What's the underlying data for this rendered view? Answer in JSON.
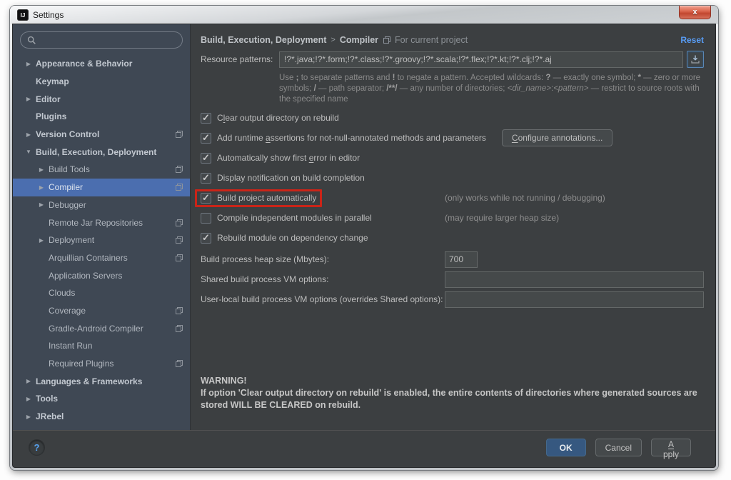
{
  "window": {
    "title": "Settings",
    "app_icon_text": "IJ",
    "close_glyph": "x"
  },
  "colors": {
    "selection": "#4b6eaf",
    "link": "#589df6",
    "highlight_box": "#cb2418",
    "ok_button": "#365880"
  },
  "sidebar": {
    "search_placeholder": "",
    "items": [
      {
        "id": "appearance-behavior",
        "label": "Appearance & Behavior",
        "level": 0,
        "arrow": "collapsed",
        "bold": true,
        "badge": false,
        "selected": false
      },
      {
        "id": "keymap",
        "label": "Keymap",
        "level": 0,
        "arrow": "none",
        "bold": true,
        "badge": false,
        "selected": false
      },
      {
        "id": "editor",
        "label": "Editor",
        "level": 0,
        "arrow": "collapsed",
        "bold": true,
        "badge": false,
        "selected": false
      },
      {
        "id": "plugins",
        "label": "Plugins",
        "level": 0,
        "arrow": "none",
        "bold": true,
        "badge": false,
        "selected": false
      },
      {
        "id": "version-control",
        "label": "Version Control",
        "level": 0,
        "arrow": "collapsed",
        "bold": true,
        "badge": true,
        "selected": false
      },
      {
        "id": "build-execution-deployment",
        "label": "Build, Execution, Deployment",
        "level": 0,
        "arrow": "expanded",
        "bold": true,
        "badge": false,
        "selected": false
      },
      {
        "id": "build-tools",
        "label": "Build Tools",
        "level": 1,
        "arrow": "collapsed",
        "bold": false,
        "badge": true,
        "selected": false
      },
      {
        "id": "compiler",
        "label": "Compiler",
        "level": 1,
        "arrow": "collapsed",
        "bold": false,
        "badge": true,
        "selected": true
      },
      {
        "id": "debugger",
        "label": "Debugger",
        "level": 1,
        "arrow": "collapsed",
        "bold": false,
        "badge": false,
        "selected": false
      },
      {
        "id": "remote-jar-repositories",
        "label": "Remote Jar Repositories",
        "level": 1,
        "arrow": "none",
        "bold": false,
        "badge": true,
        "selected": false
      },
      {
        "id": "deployment",
        "label": "Deployment",
        "level": 1,
        "arrow": "collapsed",
        "bold": false,
        "badge": true,
        "selected": false
      },
      {
        "id": "arquillian-containers",
        "label": "Arquillian Containers",
        "level": 1,
        "arrow": "none",
        "bold": false,
        "badge": true,
        "selected": false
      },
      {
        "id": "application-servers",
        "label": "Application Servers",
        "level": 1,
        "arrow": "none",
        "bold": false,
        "badge": false,
        "selected": false
      },
      {
        "id": "clouds",
        "label": "Clouds",
        "level": 1,
        "arrow": "none",
        "bold": false,
        "badge": false,
        "selected": false
      },
      {
        "id": "coverage",
        "label": "Coverage",
        "level": 1,
        "arrow": "none",
        "bold": false,
        "badge": true,
        "selected": false
      },
      {
        "id": "gradle-android-compiler",
        "label": "Gradle-Android Compiler",
        "level": 1,
        "arrow": "none",
        "bold": false,
        "badge": true,
        "selected": false
      },
      {
        "id": "instant-run",
        "label": "Instant Run",
        "level": 1,
        "arrow": "none",
        "bold": false,
        "badge": false,
        "selected": false
      },
      {
        "id": "required-plugins",
        "label": "Required Plugins",
        "level": 1,
        "arrow": "none",
        "bold": false,
        "badge": true,
        "selected": false
      },
      {
        "id": "languages-frameworks",
        "label": "Languages & Frameworks",
        "level": 0,
        "arrow": "collapsed",
        "bold": true,
        "badge": false,
        "selected": false
      },
      {
        "id": "tools",
        "label": "Tools",
        "level": 0,
        "arrow": "collapsed",
        "bold": true,
        "badge": false,
        "selected": false
      },
      {
        "id": "jrebel",
        "label": "JRebel",
        "level": 0,
        "arrow": "collapsed",
        "bold": true,
        "badge": false,
        "selected": false
      }
    ]
  },
  "header": {
    "path": "Build, Execution, Deployment",
    "sep": ">",
    "current": "Compiler",
    "scope": "For current project",
    "reset": "Reset"
  },
  "form": {
    "resource_patterns": {
      "label": "Resource patterns:",
      "value": "!?*.java;!?*.form;!?*.class;!?*.groovy;!?*.scala;!?*.flex;!?*.kt;!?*.clj;!?*.aj",
      "help_segments": [
        {
          "t": "Use "
        },
        {
          "t": ";",
          "b": 1
        },
        {
          "t": " to separate patterns and "
        },
        {
          "t": "!",
          "b": 1
        },
        {
          "t": " to negate a pattern. Accepted wildcards: "
        },
        {
          "t": "?",
          "b": 1
        },
        {
          "t": " — exactly one symbol; "
        },
        {
          "t": "*",
          "b": 1
        },
        {
          "t": " — zero or more symbols; "
        },
        {
          "t": "/",
          "b": 1
        },
        {
          "t": " — path separator; "
        },
        {
          "t": "/**/",
          "b": 1
        },
        {
          "t": " — any number of directories; "
        },
        {
          "t": "<dir_name>",
          "i": 1
        },
        {
          "t": ":"
        },
        {
          "t": "<pattern>",
          "i": 1
        },
        {
          "t": " — restrict to source roots with the specified name"
        }
      ]
    },
    "checkboxes": [
      {
        "id": "clear-output-directory",
        "checked": true,
        "boxed": false,
        "label": {
          "pre": "C",
          "mn": "l",
          "post": "ear output directory on rebuild"
        }
      },
      {
        "id": "add-runtime-assertions",
        "checked": true,
        "boxed": false,
        "label": {
          "pre": "Add runtime ",
          "mn": "a",
          "post": "ssertions for not-null-annotated methods and parameters"
        },
        "button": {
          "pre": "",
          "mn": "C",
          "post": "onfigure annotations..."
        }
      },
      {
        "id": "show-first-error",
        "checked": true,
        "boxed": false,
        "label": {
          "pre": "Automatically show first ",
          "mn": "e",
          "post": "rror in editor"
        }
      },
      {
        "id": "display-notification",
        "checked": true,
        "boxed": false,
        "label": {
          "pre": "Display notification on build completion",
          "mn": "",
          "post": ""
        }
      },
      {
        "id": "build-project-automatically",
        "checked": true,
        "boxed": true,
        "label": {
          "pre": "Build project automatically",
          "mn": "",
          "post": ""
        },
        "note": "(only works while not running / debugging)"
      },
      {
        "id": "compile-independent-modules-parallel",
        "checked": false,
        "boxed": false,
        "label": {
          "pre": "Compile independent modules in parallel",
          "mn": "",
          "post": ""
        },
        "note": "(may require larger heap size)"
      },
      {
        "id": "rebuild-module-on-dependency-change",
        "checked": true,
        "boxed": false,
        "label": {
          "pre": "Rebuild module on dependency change",
          "mn": "",
          "post": ""
        }
      }
    ],
    "fields": [
      {
        "id": "heap-size",
        "label": "Build process heap size (Mbytes):",
        "value": "700",
        "size": "small"
      },
      {
        "id": "shared-vm-options",
        "label": "Shared build process VM options:",
        "value": "",
        "size": "large"
      },
      {
        "id": "user-local-vm-options",
        "label": "User-local build process VM options (overrides Shared options):",
        "value": "",
        "size": "large"
      }
    ]
  },
  "warning": {
    "title": "WARNING!",
    "body": "If option 'Clear output directory on rebuild' is enabled, the entire contents of directories where generated sources are stored WILL BE CLEARED on rebuild."
  },
  "footer": {
    "help_glyph": "?",
    "ok": "OK",
    "cancel": "Cancel",
    "apply": {
      "pre": "",
      "mn": "A",
      "post": "pply"
    }
  }
}
